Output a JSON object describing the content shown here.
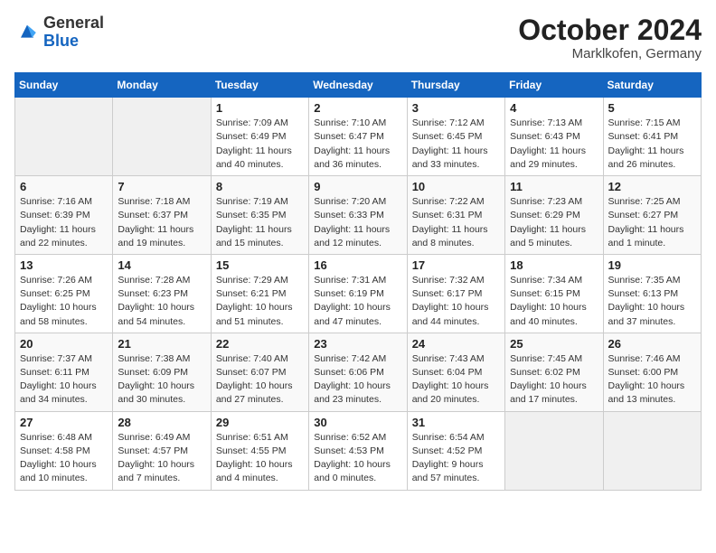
{
  "header": {
    "logo_general": "General",
    "logo_blue": "Blue",
    "month_year": "October 2024",
    "location": "Marklkofen, Germany"
  },
  "weekdays": [
    "Sunday",
    "Monday",
    "Tuesday",
    "Wednesday",
    "Thursday",
    "Friday",
    "Saturday"
  ],
  "weeks": [
    [
      {
        "day": "",
        "info": ""
      },
      {
        "day": "",
        "info": ""
      },
      {
        "day": "1",
        "info": "Sunrise: 7:09 AM\nSunset: 6:49 PM\nDaylight: 11 hours and 40 minutes."
      },
      {
        "day": "2",
        "info": "Sunrise: 7:10 AM\nSunset: 6:47 PM\nDaylight: 11 hours and 36 minutes."
      },
      {
        "day": "3",
        "info": "Sunrise: 7:12 AM\nSunset: 6:45 PM\nDaylight: 11 hours and 33 minutes."
      },
      {
        "day": "4",
        "info": "Sunrise: 7:13 AM\nSunset: 6:43 PM\nDaylight: 11 hours and 29 minutes."
      },
      {
        "day": "5",
        "info": "Sunrise: 7:15 AM\nSunset: 6:41 PM\nDaylight: 11 hours and 26 minutes."
      }
    ],
    [
      {
        "day": "6",
        "info": "Sunrise: 7:16 AM\nSunset: 6:39 PM\nDaylight: 11 hours and 22 minutes."
      },
      {
        "day": "7",
        "info": "Sunrise: 7:18 AM\nSunset: 6:37 PM\nDaylight: 11 hours and 19 minutes."
      },
      {
        "day": "8",
        "info": "Sunrise: 7:19 AM\nSunset: 6:35 PM\nDaylight: 11 hours and 15 minutes."
      },
      {
        "day": "9",
        "info": "Sunrise: 7:20 AM\nSunset: 6:33 PM\nDaylight: 11 hours and 12 minutes."
      },
      {
        "day": "10",
        "info": "Sunrise: 7:22 AM\nSunset: 6:31 PM\nDaylight: 11 hours and 8 minutes."
      },
      {
        "day": "11",
        "info": "Sunrise: 7:23 AM\nSunset: 6:29 PM\nDaylight: 11 hours and 5 minutes."
      },
      {
        "day": "12",
        "info": "Sunrise: 7:25 AM\nSunset: 6:27 PM\nDaylight: 11 hours and 1 minute."
      }
    ],
    [
      {
        "day": "13",
        "info": "Sunrise: 7:26 AM\nSunset: 6:25 PM\nDaylight: 10 hours and 58 minutes."
      },
      {
        "day": "14",
        "info": "Sunrise: 7:28 AM\nSunset: 6:23 PM\nDaylight: 10 hours and 54 minutes."
      },
      {
        "day": "15",
        "info": "Sunrise: 7:29 AM\nSunset: 6:21 PM\nDaylight: 10 hours and 51 minutes."
      },
      {
        "day": "16",
        "info": "Sunrise: 7:31 AM\nSunset: 6:19 PM\nDaylight: 10 hours and 47 minutes."
      },
      {
        "day": "17",
        "info": "Sunrise: 7:32 AM\nSunset: 6:17 PM\nDaylight: 10 hours and 44 minutes."
      },
      {
        "day": "18",
        "info": "Sunrise: 7:34 AM\nSunset: 6:15 PM\nDaylight: 10 hours and 40 minutes."
      },
      {
        "day": "19",
        "info": "Sunrise: 7:35 AM\nSunset: 6:13 PM\nDaylight: 10 hours and 37 minutes."
      }
    ],
    [
      {
        "day": "20",
        "info": "Sunrise: 7:37 AM\nSunset: 6:11 PM\nDaylight: 10 hours and 34 minutes."
      },
      {
        "day": "21",
        "info": "Sunrise: 7:38 AM\nSunset: 6:09 PM\nDaylight: 10 hours and 30 minutes."
      },
      {
        "day": "22",
        "info": "Sunrise: 7:40 AM\nSunset: 6:07 PM\nDaylight: 10 hours and 27 minutes."
      },
      {
        "day": "23",
        "info": "Sunrise: 7:42 AM\nSunset: 6:06 PM\nDaylight: 10 hours and 23 minutes."
      },
      {
        "day": "24",
        "info": "Sunrise: 7:43 AM\nSunset: 6:04 PM\nDaylight: 10 hours and 20 minutes."
      },
      {
        "day": "25",
        "info": "Sunrise: 7:45 AM\nSunset: 6:02 PM\nDaylight: 10 hours and 17 minutes."
      },
      {
        "day": "26",
        "info": "Sunrise: 7:46 AM\nSunset: 6:00 PM\nDaylight: 10 hours and 13 minutes."
      }
    ],
    [
      {
        "day": "27",
        "info": "Sunrise: 6:48 AM\nSunset: 4:58 PM\nDaylight: 10 hours and 10 minutes."
      },
      {
        "day": "28",
        "info": "Sunrise: 6:49 AM\nSunset: 4:57 PM\nDaylight: 10 hours and 7 minutes."
      },
      {
        "day": "29",
        "info": "Sunrise: 6:51 AM\nSunset: 4:55 PM\nDaylight: 10 hours and 4 minutes."
      },
      {
        "day": "30",
        "info": "Sunrise: 6:52 AM\nSunset: 4:53 PM\nDaylight: 10 hours and 0 minutes."
      },
      {
        "day": "31",
        "info": "Sunrise: 6:54 AM\nSunset: 4:52 PM\nDaylight: 9 hours and 57 minutes."
      },
      {
        "day": "",
        "info": ""
      },
      {
        "day": "",
        "info": ""
      }
    ]
  ]
}
